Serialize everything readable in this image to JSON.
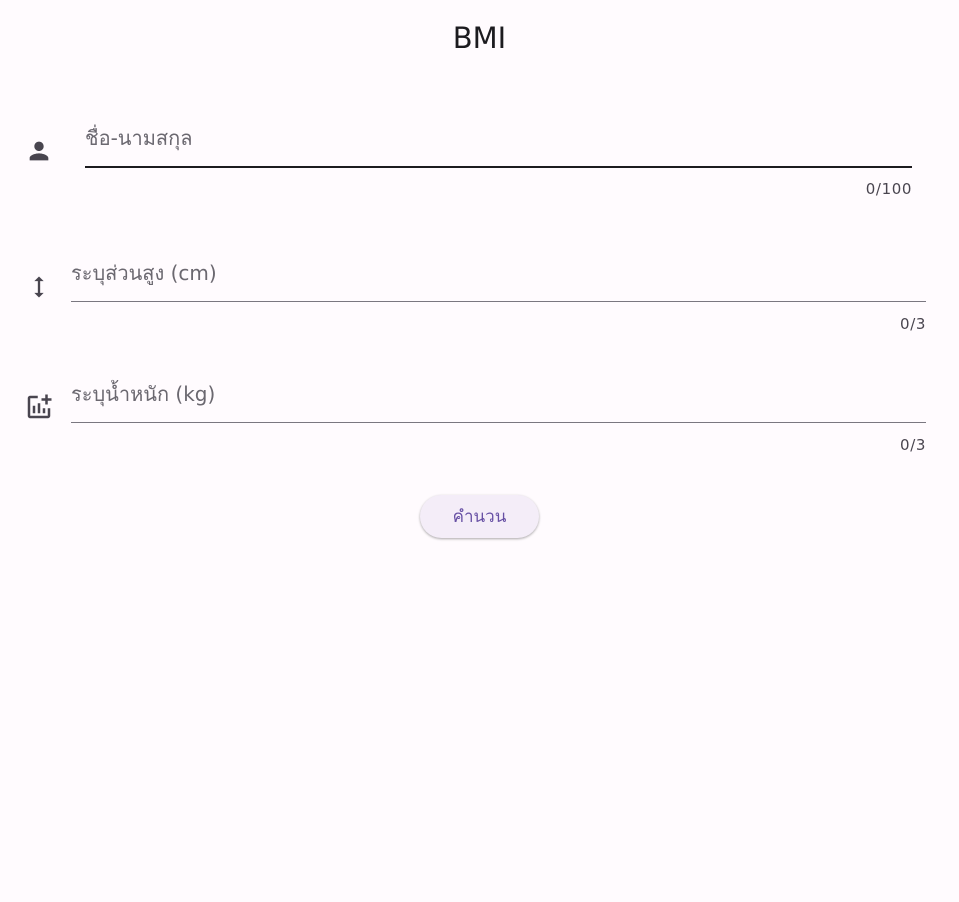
{
  "app": {
    "title": "BMI"
  },
  "form": {
    "name_field": {
      "placeholder": "ชื่อ-นามสกุล",
      "value": "",
      "counter": "0/100",
      "icon": "person-icon"
    },
    "height_field": {
      "placeholder": "ระบุส่วนสูง (cm)",
      "value": "",
      "counter": "0/3",
      "icon": "height-arrows-icon"
    },
    "weight_field": {
      "placeholder": "ระบุน้ำหนัก (kg)",
      "value": "",
      "counter": "0/3",
      "icon": "add-chart-icon"
    },
    "calculate_button": {
      "label": "คำนวน"
    }
  },
  "colors": {
    "background": "#fffbfe",
    "text": "#1c1b1f",
    "button_bg": "#f4edf8",
    "button_text": "#6750a4"
  }
}
